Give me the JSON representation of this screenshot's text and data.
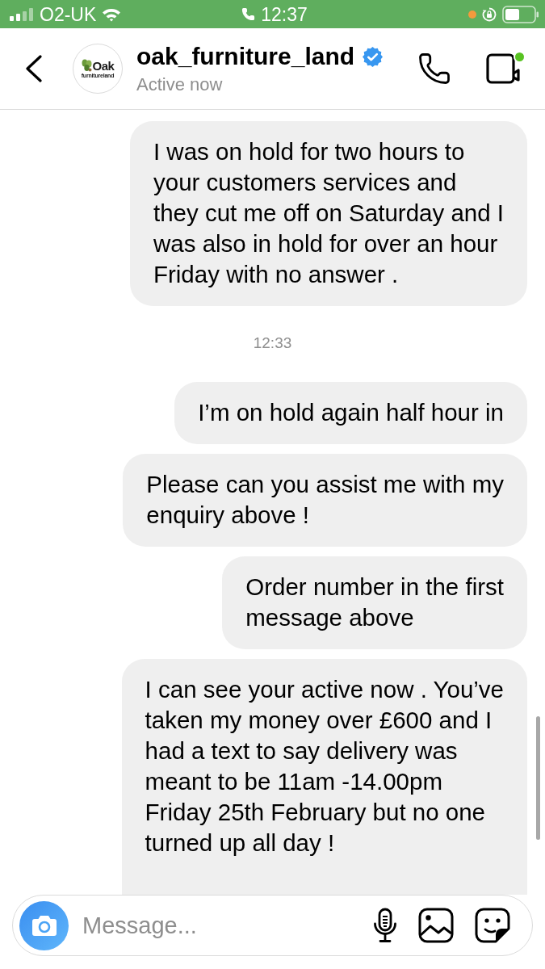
{
  "status_bar": {
    "carrier": "O2-UK",
    "time": "12:37"
  },
  "header": {
    "avatar": {
      "wordmark": "Oak",
      "tagline": "furnitureland"
    },
    "name": "oak_furniture_land",
    "verified": true,
    "status": "Active now"
  },
  "messages": [
    {
      "kind": "message",
      "text": "I was on hold for two hours to\nyour customers services and\nthey cut me off on Saturday and I\nwas also in hold for over an hour\nFriday with no answer ."
    },
    {
      "kind": "timestamp",
      "text": "12:33"
    },
    {
      "kind": "message",
      "text": "I’m on hold again half hour in"
    },
    {
      "kind": "message",
      "text": "Please can you assist me with my\nenquiry above !"
    },
    {
      "kind": "message",
      "text": "Order number in the first\nmessage above"
    },
    {
      "kind": "message",
      "text": "I can see your active now . You’ve\ntaken my money over £600 and I\nhad a text to say delivery was\nmeant to be 11am -14.00pm\nFriday 25th February but no one\nturned up all day !"
    }
  ],
  "composer": {
    "placeholder": "Message..."
  }
}
